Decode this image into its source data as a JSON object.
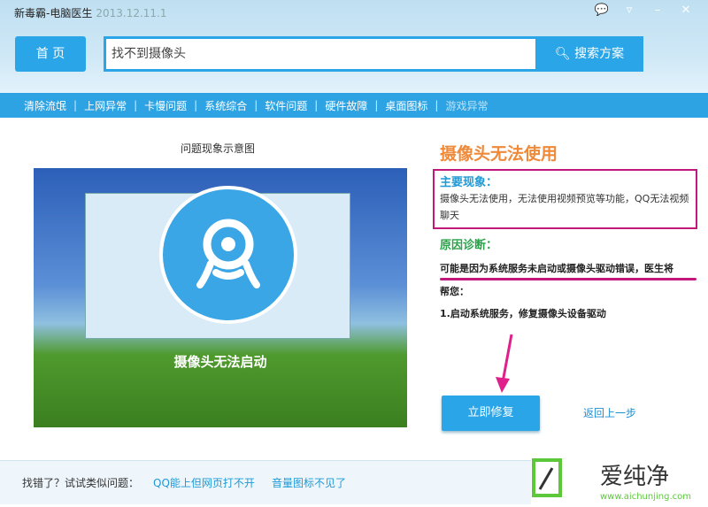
{
  "window": {
    "app_name": "新毒霸-电脑医生",
    "version": "2013.12.11.1",
    "icons": [
      "chat-icon",
      "menu-icon",
      "minimize-icon",
      "close-icon"
    ]
  },
  "header": {
    "home_label": "首 页",
    "search_value": "找不到摄像头",
    "search_button": "搜索方案"
  },
  "nav": {
    "items": [
      "清除流氓",
      "上网异常",
      "卡慢问题",
      "系统综合",
      "软件问题",
      "硬件故障",
      "桌面图标",
      "游戏异常"
    ]
  },
  "illustration": {
    "caption": "问题现象示意图",
    "overlay_text": "摄像头无法启动"
  },
  "detail": {
    "title": "摄像头无法使用",
    "symptom_heading": "主要现象：",
    "symptom_text": "摄像头无法使用，无法使用视频预览等功能，QQ无法视频聊天",
    "diagnosis_heading": "原因诊断：",
    "diagnosis_text": "可能是因为系统服务未启动或摄像头驱动错误，医生将",
    "diagnosis_text2": "帮您：",
    "step": "1.启动系统服务，修复摄像头设备驱动",
    "fix_button": "立即修复",
    "back_link": "返回上一步"
  },
  "footer": {
    "prompt": "找错了？试试类似问题：",
    "links": [
      "QQ能上但网页打不开",
      "音量图标不见了"
    ]
  },
  "watermark": {
    "name": "爱纯净",
    "url": "www.aichunjing.com"
  },
  "colors": {
    "accent": "#2aa6e8",
    "title": "#ee8a3a",
    "highlight": "#c2187b"
  }
}
